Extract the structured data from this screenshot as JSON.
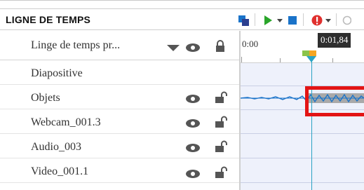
{
  "header": {
    "title": "LIGNE DE TEMPS"
  },
  "toolbar": {
    "icons": [
      "layers-icon",
      "play-icon",
      "dropdown-arrow-icon",
      "stop-icon",
      "alert-icon",
      "dropdown-arrow-icon"
    ]
  },
  "tracks": [
    {
      "label": "Linge de temps pr...",
      "has_dropdown": true
    },
    {
      "label": "Diapositive"
    },
    {
      "label": "Objets"
    },
    {
      "label": "Webcam_001.3"
    },
    {
      "label": "Audio_003"
    },
    {
      "label": "Video_001.1"
    }
  ],
  "timeline": {
    "start_label": "0:00",
    "playhead_time": "0:01,84"
  },
  "colors": {
    "accent_blue": "#1a73c9",
    "play_green": "#2aa52a",
    "alert_red": "#e0302e",
    "selection_red": "#e31414",
    "playhead": "#2aa3c4",
    "timeline_bg": "#eef1fb"
  }
}
